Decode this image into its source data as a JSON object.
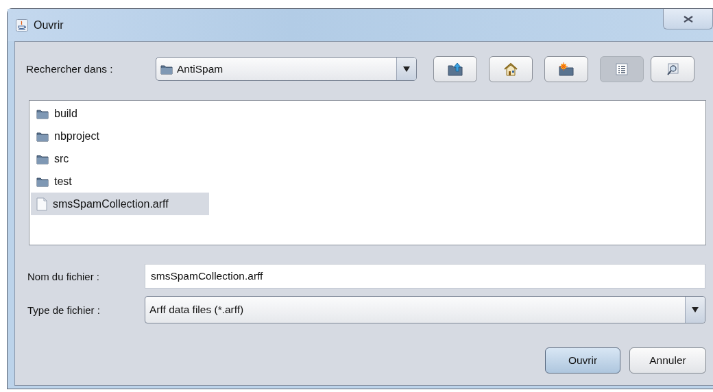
{
  "window": {
    "title": "Ouvrir"
  },
  "look_in": {
    "label": "Rechercher dans :",
    "value": "AntiSpam"
  },
  "toolbar_buttons": [
    {
      "kind": "up",
      "selected": false
    },
    {
      "kind": "home",
      "selected": false
    },
    {
      "kind": "new-folder",
      "selected": false
    },
    {
      "kind": "list-view",
      "selected": true
    },
    {
      "kind": "details-view",
      "selected": false
    }
  ],
  "files": [
    {
      "kind": "folder",
      "name": "build",
      "selected": false
    },
    {
      "kind": "folder",
      "name": "nbproject",
      "selected": false
    },
    {
      "kind": "folder",
      "name": "src",
      "selected": false
    },
    {
      "kind": "folder",
      "name": "test",
      "selected": false
    },
    {
      "kind": "file",
      "name": "smsSpamCollection.arff",
      "selected": true
    }
  ],
  "file_name": {
    "label": "Nom du fichier :",
    "value": "smsSpamCollection.arff"
  },
  "file_type": {
    "label": "Type de fichier :",
    "value": "Arff data files (*.arff)"
  },
  "buttons": [
    {
      "label": "Ouvrir",
      "default": true
    },
    {
      "label": "Annuler",
      "default": false
    }
  ]
}
